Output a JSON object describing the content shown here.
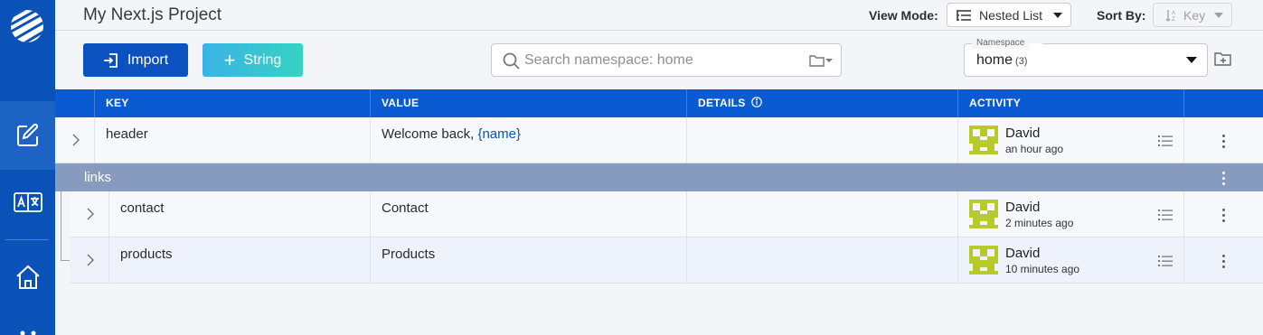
{
  "app": {
    "project_title": "My Next.js Project"
  },
  "topbar": {
    "view_mode_label": "View Mode:",
    "view_mode_value": "Nested List",
    "sort_by_label": "Sort By:",
    "sort_by_value": "Key"
  },
  "toolbar": {
    "import_label": "Import",
    "string_label": "String",
    "search_placeholder": "Search namespace: home",
    "namespace_legend": "Namespace",
    "namespace_value": "home",
    "namespace_count": "(3)"
  },
  "table": {
    "columns": [
      "KEY",
      "VALUE",
      "DETAILS",
      "ACTIVITY"
    ],
    "rows": [
      {
        "key": "header",
        "value_prefix": "Welcome back, ",
        "value_var": "{name}",
        "user": "David",
        "time": "an hour ago"
      }
    ],
    "group": {
      "label": "links",
      "rows": [
        {
          "key": "contact",
          "value": "Contact",
          "user": "David",
          "time": "2 minutes ago"
        },
        {
          "key": "products",
          "value": "Products",
          "user": "David",
          "time": "10 minutes ago"
        }
      ]
    }
  },
  "colors": {
    "sidebar": "#0a51b8",
    "header": "#0a5bd1",
    "group_row": "#869bbd",
    "avatar": "#b7c92c"
  },
  "icons": [
    "globe-logo-icon",
    "edit-icon",
    "translate-icon",
    "home-icon",
    "search-icon",
    "folder-icon",
    "import-icon",
    "plus-icon",
    "list-icon",
    "kebab-icon",
    "chevron-right-icon",
    "info-icon",
    "sort-icon",
    "folder-plus-icon"
  ]
}
